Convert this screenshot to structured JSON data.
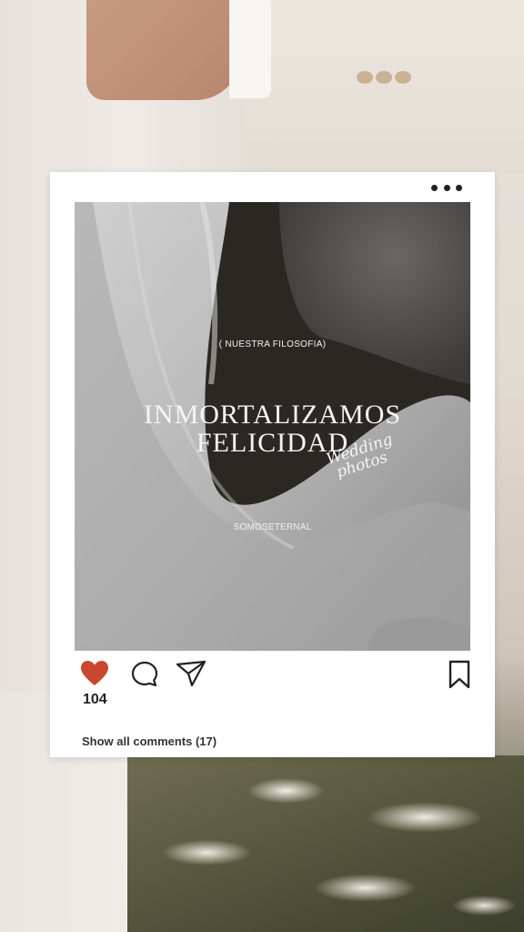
{
  "post": {
    "kicker": "( NUESTRA FILOSOFIA)",
    "headline_line1": "INMORTALIZAMOS",
    "headline_line2": "FELICIDAD",
    "script_line1": "Wedding",
    "script_line2": "photos",
    "brand": "SOMOSETERNAL",
    "likes": "104",
    "comments_link": "Show all comments (17)"
  },
  "icons": {
    "more": "more-dots-icon",
    "like": "heart-icon",
    "comment": "comment-icon",
    "share": "send-icon",
    "save": "bookmark-icon"
  },
  "colors": {
    "heart": "#c8472d",
    "card": "#ffffff",
    "text": "#222222"
  }
}
